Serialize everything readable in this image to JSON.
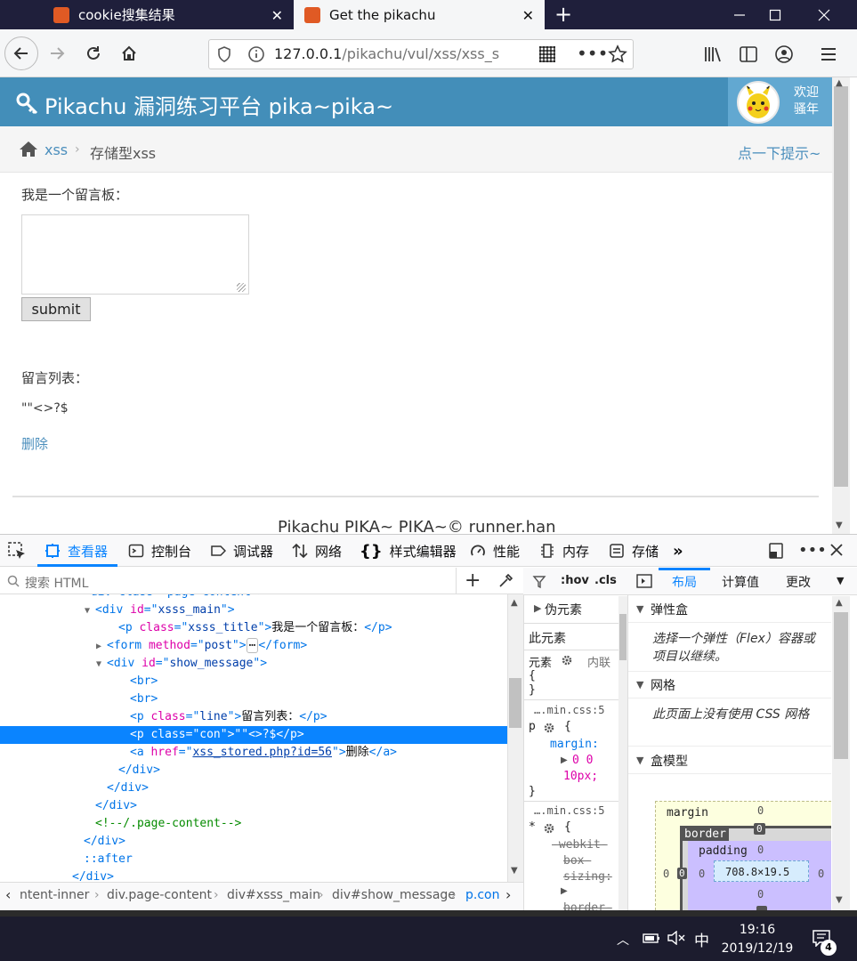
{
  "browser": {
    "tabs": [
      {
        "title": "cookie搜集结果",
        "favicon": "pikachu-favicon",
        "active": false
      },
      {
        "title": "Get the pikachu",
        "favicon": "pikachu-favicon",
        "active": true
      }
    ],
    "url": {
      "host": "127.0.0.1",
      "path": "/pikachu/vul/xss/xss_s"
    }
  },
  "page": {
    "brand": "Pikachu 漏洞练习平台 pika~pika~",
    "welcome_line1": "欢迎",
    "welcome_line2": "骚年",
    "breadcrumb": {
      "home": "xss",
      "separator": "›",
      "current": "存储型xss"
    },
    "hint_link": "点一下提示~",
    "board_title": "我是一个留言板：",
    "submit_label": "submit",
    "list_title": "留言列表：",
    "message_content": "\"\"<>?$",
    "delete_label": "删除",
    "footer_text": "Pikachu PIKA~ PIKA~© runner.han"
  },
  "devtools": {
    "tools": [
      "查看器",
      "控制台",
      "调试器",
      "网络",
      "样式编辑器",
      "性能",
      "内存",
      "存储"
    ],
    "search_placeholder": "搜索 HTML",
    "markup": [
      {
        "indent": 6,
        "twisty": "",
        "html": "<div class=\"page-content\">"
      },
      {
        "indent": 7,
        "twisty": "▼",
        "open": "div",
        "attrs": [
          [
            "id",
            "xsss_main"
          ]
        ],
        "text": "",
        "close": ""
      },
      {
        "indent": 9,
        "twisty": "",
        "open": "p",
        "attrs": [
          [
            "class",
            "xsss_title"
          ]
        ],
        "text": "我是一个留言板：",
        "close": "p"
      },
      {
        "indent": 8,
        "twisty": "▶",
        "open": "form",
        "attrs": [
          [
            "method",
            "post"
          ]
        ],
        "text": "⋯",
        "close": "form"
      },
      {
        "indent": 8,
        "twisty": "▼",
        "open": "div",
        "attrs": [
          [
            "id",
            "show_message"
          ]
        ],
        "text": "",
        "close": ""
      },
      {
        "indent": 10,
        "twisty": "",
        "open": "br",
        "attrs": [],
        "text": "",
        "close": ""
      },
      {
        "indent": 10,
        "twisty": "",
        "open": "br",
        "attrs": [],
        "text": "",
        "close": ""
      },
      {
        "indent": 10,
        "twisty": "",
        "open": "p",
        "attrs": [
          [
            "class",
            "line"
          ]
        ],
        "text": "留言列表：",
        "close": "p"
      },
      {
        "indent": 10,
        "twisty": "",
        "open": "p",
        "attrs": [
          [
            "class",
            "con"
          ]
        ],
        "text": "\"\"<>?$",
        "close": "p",
        "selected": true
      },
      {
        "indent": 10,
        "twisty": "",
        "open": "a",
        "attrs": [
          [
            "href",
            "xss_stored.php?id=56"
          ]
        ],
        "text": "删除",
        "close": "a"
      },
      {
        "indent": 9,
        "twisty": "",
        "closing": "div"
      },
      {
        "indent": 8,
        "twisty": "",
        "closing": "div"
      },
      {
        "indent": 7,
        "twisty": "",
        "closing": "div"
      },
      {
        "indent": 7,
        "twisty": "",
        "comment": "<!--/.page-content-->"
      },
      {
        "indent": 6,
        "twisty": "",
        "closing": "div"
      },
      {
        "indent": 6,
        "twisty": "",
        "pseudo": "::after"
      },
      {
        "indent": 5,
        "twisty": "",
        "closing": "div"
      }
    ],
    "breadcrumbs": [
      "ntent-inner",
      "div.page-content",
      "div#xsss_main",
      "div#show_message",
      "p.con"
    ],
    "rules": {
      "hov": ":hov",
      "cls": ".cls",
      "pseudo_elements": "伪元素",
      "this_element": "此元素",
      "element_label": "元素",
      "inline_label": "内联",
      "source1": "….min.css:5",
      "rule1_selector": "p",
      "rule1_prop": "margin:",
      "rule1_value": "0 0",
      "rule1_value2": "10px;",
      "source2": "….min.css:5",
      "rule2_selector": "*",
      "rule2_prop1": "-webkit-",
      "rule2_prop2": "box-",
      "rule2_prop3": "sizing:",
      "rule2_prop4": "border-"
    },
    "layout": {
      "tabs": [
        "布局",
        "计算值",
        "更改"
      ],
      "flexbox_title": "弹性盒",
      "flexbox_text": "选择一个弹性（Flex）容器或项目以继续。",
      "grid_title": "网格",
      "grid_text": "此页面上没有使用 CSS 网格",
      "boxmodel_title": "盒模型",
      "margin_label": "margin",
      "border_label": "border",
      "padding_label": "padding",
      "zero": "0",
      "content_size": "708.8×19.5"
    }
  },
  "taskbar": {
    "ime": "中",
    "time": "19:16",
    "date": "2019/12/19",
    "notifications": "4"
  }
}
